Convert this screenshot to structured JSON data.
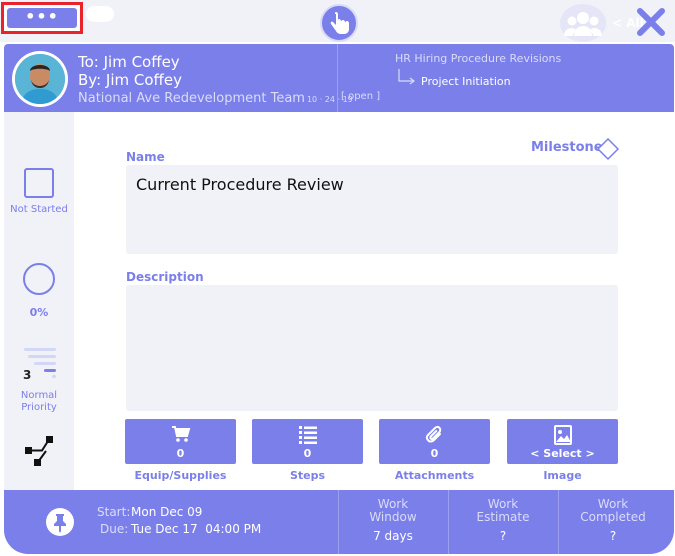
{
  "topbar": {
    "menu_label": "•••",
    "all_label": "< All"
  },
  "header": {
    "to": "To: Jim Coffey",
    "by": "By: Jim Coffey",
    "team": "National Ave Redevelopment Team",
    "team_date": "10 · 24 · 19",
    "open_tag": "[ open ]",
    "project": "HR Hiring Procedure Revisions",
    "phase": "Project Initiation"
  },
  "sidebar": {
    "status": "Not Started",
    "progress": "0%",
    "priority_number": "3",
    "priority_label_1": "Normal",
    "priority_label_2": "Priority"
  },
  "form": {
    "name_label": "Name",
    "name_value": "Current Procedure Review",
    "milestone_label": "Milestone",
    "description_label": "Description",
    "description_value": ""
  },
  "tiles": [
    {
      "label": "Equip/Supplies",
      "value": "0",
      "icon": "cart-icon"
    },
    {
      "label": "Steps",
      "value": "0",
      "icon": "list-icon"
    },
    {
      "label": "Attachments",
      "value": "0",
      "icon": "paperclip-icon"
    },
    {
      "label": "Image",
      "value": "< Select >",
      "icon": "image-icon"
    }
  ],
  "footer": {
    "start_key": "Start:",
    "start_val": "Mon Dec 09",
    "due_key": "Due:",
    "due_val": "Tue Dec 17  04:00 PM",
    "work_window_title_1": "Work",
    "work_window_title_2": "Window",
    "work_window_val": "7 days",
    "work_estimate_title_1": "Work",
    "work_estimate_title_2": "Estimate",
    "work_estimate_val": "?",
    "work_completed_title_1": "Work",
    "work_completed_title_2": "Completed",
    "work_completed_val": "?"
  },
  "colors": {
    "accent": "#7b7fe9",
    "panel": "#f1f1f8",
    "highlight": "#e8242a"
  }
}
